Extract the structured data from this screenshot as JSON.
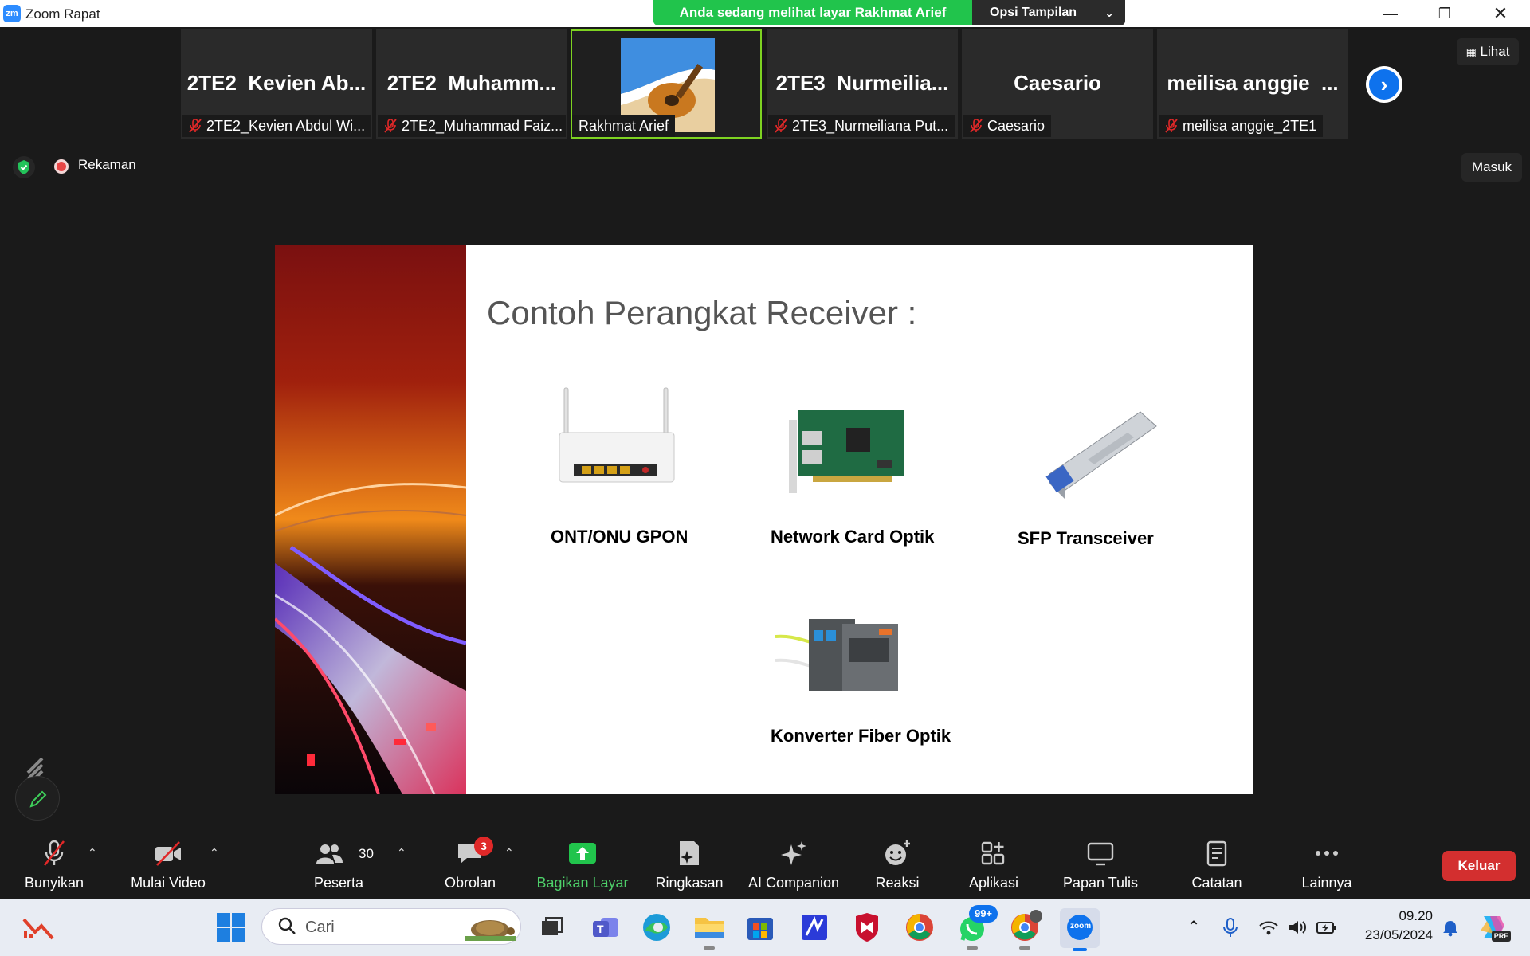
{
  "window": {
    "app_logo": "zm",
    "title": "Zoom Rapat"
  },
  "share_banner": {
    "text": "Anda sedang melihat layar Rakhmat Arief",
    "view_options": "Opsi Tampilan"
  },
  "gallery": {
    "tiles": [
      {
        "big": "2TE2_Kevien  Ab...",
        "name": "2TE2_Kevien Abdul Wi..."
      },
      {
        "big": "2TE2_Muhamm...",
        "name": "2TE2_Muhammad Faiz..."
      },
      {
        "name": "Rakhmat Arief",
        "active": true
      },
      {
        "big": "2TE3_Nurmeilia...",
        "name": "2TE3_Nurmeiliana Put..."
      },
      {
        "big": "Caesario",
        "name": "Caesario"
      },
      {
        "big": "meilisa  anggie_...",
        "name": "meilisa anggie_2TE1"
      }
    ],
    "view_button": "Lihat"
  },
  "status": {
    "recording": "Rekaman",
    "enter_button": "Masuk"
  },
  "slide": {
    "title": "Contoh Perangkat Receiver :",
    "devices": [
      {
        "label": "ONT/ONU GPON"
      },
      {
        "label": "Network Card Optik"
      },
      {
        "label": "SFP Transceiver"
      },
      {
        "label": "Konverter Fiber Optik"
      }
    ]
  },
  "toolbar": {
    "mute": "Bunyikan",
    "video": "Mulai Video",
    "participants": "Peserta",
    "participants_count": "30",
    "chat": "Obrolan",
    "chat_badge": "3",
    "share": "Bagikan Layar",
    "summary": "Ringkasan",
    "ai": "AI Companion",
    "reactions": "Reaksi",
    "apps": "Aplikasi",
    "whiteboard": "Papan Tulis",
    "notes": "Catatan",
    "more": "Lainnya",
    "leave": "Keluar"
  },
  "taskbar": {
    "search_placeholder": "Cari",
    "whatsapp_badge": "99+",
    "time": "09.20",
    "date": "23/05/2024",
    "zoom_label": "zoom",
    "copilot_badge": "PRE"
  },
  "colors": {
    "share_green": "#21c44c",
    "zoom_blue": "#0e72ed",
    "leave_red": "#d32f2f",
    "active_border": "#7ed321"
  }
}
